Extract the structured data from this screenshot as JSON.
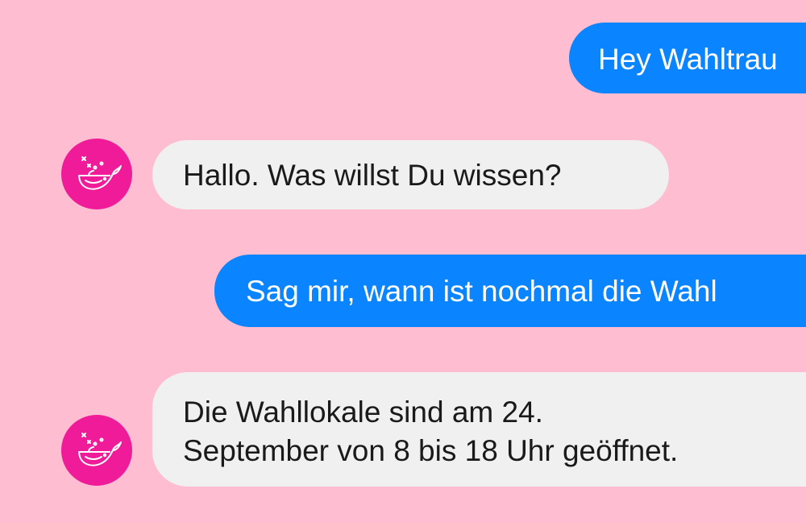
{
  "colors": {
    "background": "#FFBDD2",
    "outgoing_bubble": "#0A84FF",
    "incoming_bubble": "#F0F0F0",
    "avatar": "#F01B99"
  },
  "bot": {
    "avatar_icon": "whale-icon"
  },
  "messages": [
    {
      "sender": "user",
      "text": "Hey Wahltrau"
    },
    {
      "sender": "bot",
      "text": "Hallo. Was willst Du wissen?"
    },
    {
      "sender": "user",
      "text": "Sag mir, wann ist nochmal die Wahl"
    },
    {
      "sender": "bot",
      "lines": [
        "Die Wahllokale sind am 24.",
        "September von 8 bis 18 Uhr geöffnet."
      ]
    }
  ]
}
